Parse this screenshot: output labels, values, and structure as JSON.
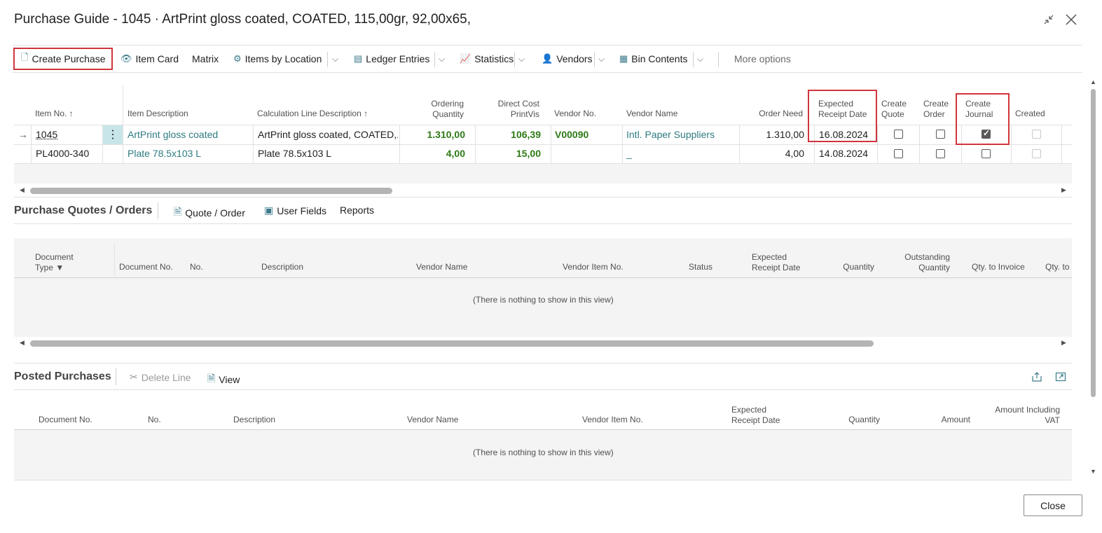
{
  "window": {
    "title": "Purchase Guide - 1045 · ArtPrint gloss coated, COATED, 115,00gr, 92,00x65,",
    "icons": [
      "collapse-icon",
      "close-icon"
    ]
  },
  "actions": {
    "create_purchase": "Create Purchase",
    "item_card": "Item Card",
    "matrix": "Matrix",
    "items_by_location": "Items by Location",
    "ledger_entries": "Ledger Entries",
    "statistics": "Statistics",
    "vendors": "Vendors",
    "bin_contents": "Bin Contents",
    "more_options": "More options"
  },
  "lines": {
    "columns": {
      "item_no": "Item No. ↑",
      "item_description": "Item Description",
      "calc_line_desc": "Calculation Line Description ↑",
      "ordering_qty_1": "Ordering",
      "ordering_qty_2": "Quantity",
      "direct_cost_1": "Direct Cost",
      "direct_cost_2": "PrintVis",
      "vendor_no": "Vendor No.",
      "vendor_name": "Vendor Name",
      "order_need": "Order Need",
      "exp_receipt_1": "Expected",
      "exp_receipt_2": "Receipt Date",
      "create_quote_1": "Create",
      "create_quote_2": "Quote",
      "create_order_1": "Create",
      "create_order_2": "Order",
      "create_journal_1": "Create",
      "create_journal_2": "Journal",
      "created": "Created"
    },
    "rows": [
      {
        "item_no": "1045",
        "item_description": "ArtPrint gloss coated",
        "calc_line_desc": "ArtPrint gloss coated, COATED,...",
        "ordering_qty": "1.310,00",
        "direct_cost": "106,39",
        "vendor_no": "V00090",
        "vendor_name": "Intl. Paper Suppliers",
        "order_need": "1.310,00",
        "exp_receipt": "16.08.2024",
        "create_quote": false,
        "create_order": false,
        "create_journal": true,
        "created": false
      },
      {
        "item_no": "PL4000-340",
        "item_description": "Plate 78.5x103 L",
        "calc_line_desc": "Plate 78.5x103 L",
        "ordering_qty": "4,00",
        "direct_cost": "15,00",
        "vendor_no": "",
        "vendor_name": "_",
        "order_need": "4,00",
        "exp_receipt": "14.08.2024",
        "create_quote": false,
        "create_order": false,
        "create_journal": false,
        "created": false
      }
    ]
  },
  "quotes_orders": {
    "title": "Purchase Quotes / Orders",
    "actions": {
      "quote_order": "Quote / Order",
      "user_fields": "User Fields",
      "reports": "Reports"
    },
    "columns": {
      "doc_type_1": "Document",
      "doc_type_2": "Type",
      "document_no": "Document No.",
      "no": "No.",
      "description": "Description",
      "vendor_name": "Vendor Name",
      "vendor_item_no": "Vendor Item No.",
      "status": "Status",
      "exp_receipt_1": "Expected",
      "exp_receipt_2": "Receipt Date",
      "quantity": "Quantity",
      "outstanding_1": "Outstanding",
      "outstanding_2": "Quantity",
      "qty_to_invoice": "Qty. to Invoice",
      "qty_to": "Qty. to"
    },
    "empty_message": "(There is nothing to show in this view)"
  },
  "posted_purchases": {
    "title": "Posted Purchases",
    "actions": {
      "delete_line": "Delete Line",
      "view": "View"
    },
    "columns": {
      "document_no": "Document No.",
      "no": "No.",
      "description": "Description",
      "vendor_name": "Vendor Name",
      "vendor_item_no": "Vendor Item No.",
      "exp_receipt_1": "Expected",
      "exp_receipt_2": "Receipt Date",
      "quantity": "Quantity",
      "amount": "Amount",
      "amount_incl_1": "Amount Including",
      "amount_incl_2": "VAT"
    },
    "empty_message": "(There is nothing to show in this view)"
  },
  "footer": {
    "close_label": "Close"
  },
  "colors": {
    "link": "#2f7b80",
    "bold_value": "#2d7a15",
    "highlight_box": "#d0353d",
    "selected_row_marker": "#c8e6ea"
  }
}
